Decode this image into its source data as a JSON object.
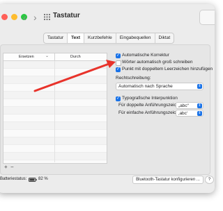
{
  "window": {
    "title": "Tastatur",
    "nav_back": "‹",
    "nav_forward": "›",
    "grid_icon": "grid-icon",
    "colors": {
      "close": "#ff5f57",
      "minimize": "#febc2e",
      "zoom": "#28c840",
      "accent": "#1a73e8",
      "arrow": "#e8332b"
    }
  },
  "tabs": [
    {
      "label": "Tastatur",
      "active": false
    },
    {
      "label": "Text",
      "active": true
    },
    {
      "label": "Kurzbefehle",
      "active": false
    },
    {
      "label": "Eingabequellen",
      "active": false
    },
    {
      "label": "Diktat",
      "active": false
    }
  ],
  "table": {
    "col_replace": "Ersetzen",
    "col_replace_sort": "⌄",
    "col_with": "Durch",
    "add": "+",
    "remove": "−"
  },
  "options": {
    "autocorrect": {
      "label": "Automatische Korrektur",
      "checked": true
    },
    "autocap": {
      "label": "Wörter automatisch groß schreiben",
      "checked": false
    },
    "period": {
      "label": "Punkt mit doppeltem Leerzeichen hinzufügen",
      "checked": true
    },
    "spelling_label": "Rechtschreibung:",
    "spelling_value": "Automatisch nach Sprache",
    "typo": {
      "label": "Typografische Interpunktion",
      "checked": true
    },
    "double_quotes_label": "Für doppelte Anführungszeichen",
    "double_quotes_value": "„abc“",
    "single_quotes_label": "Für einfache Anführungszeichen",
    "single_quotes_value": "‚abc‘"
  },
  "footer": {
    "battery_label": "Batteriestatus:",
    "battery_value": "82 %",
    "bluetooth_button": "Bluetooth-Tastatur konfigurieren ...",
    "help": "?"
  }
}
